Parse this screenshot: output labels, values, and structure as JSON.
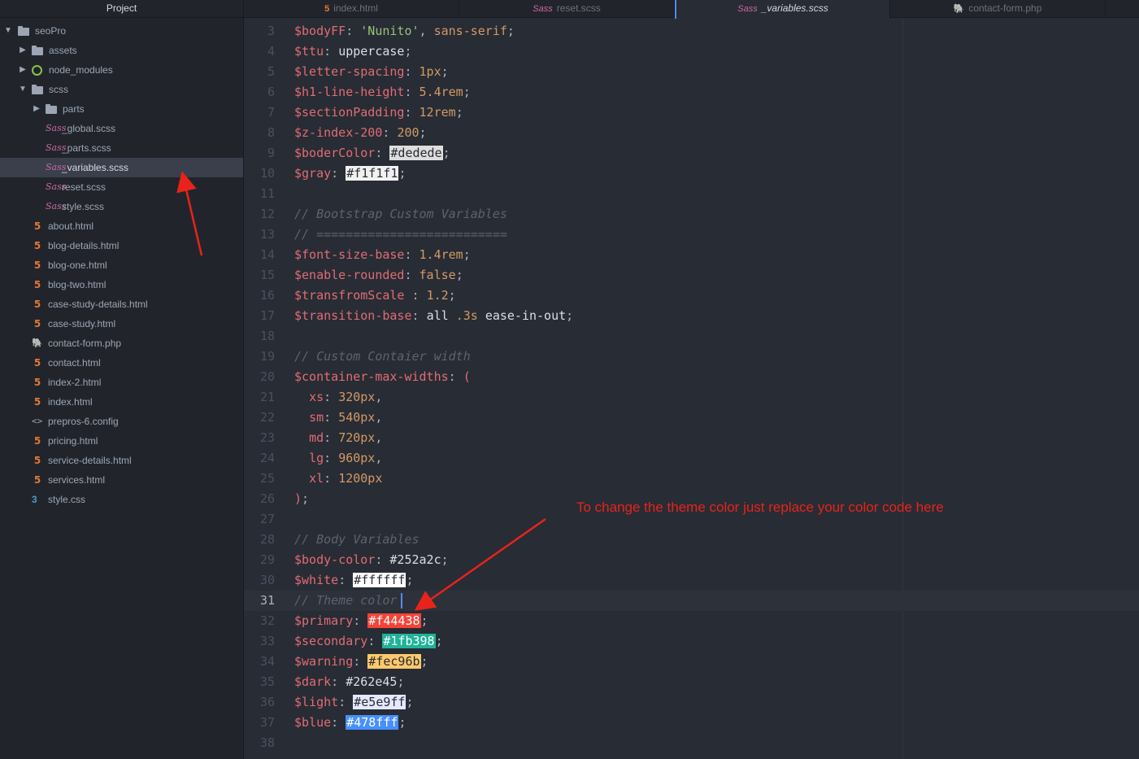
{
  "sidebar": {
    "title": "Project",
    "root": "seoPro",
    "items": [
      {
        "label": "assets",
        "type": "folder",
        "depth": 1,
        "expanded": false
      },
      {
        "label": "node_modules",
        "type": "npm",
        "depth": 1,
        "expanded": false
      },
      {
        "label": "scss",
        "type": "folder",
        "depth": 1,
        "expanded": true
      },
      {
        "label": "parts",
        "type": "folder",
        "depth": 2,
        "expanded": false
      },
      {
        "label": "_global.scss",
        "type": "sass",
        "depth": 2
      },
      {
        "label": "_parts.scss",
        "type": "sass",
        "depth": 2
      },
      {
        "label": "_variables.scss",
        "type": "sass",
        "depth": 2,
        "selected": true
      },
      {
        "label": "reset.scss",
        "type": "sass",
        "depth": 2
      },
      {
        "label": "style.scss",
        "type": "sass",
        "depth": 2
      },
      {
        "label": "about.html",
        "type": "html",
        "depth": 1
      },
      {
        "label": "blog-details.html",
        "type": "html",
        "depth": 1
      },
      {
        "label": "blog-one.html",
        "type": "html",
        "depth": 1
      },
      {
        "label": "blog-two.html",
        "type": "html",
        "depth": 1
      },
      {
        "label": "case-study-details.html",
        "type": "html",
        "depth": 1
      },
      {
        "label": "case-study.html",
        "type": "html",
        "depth": 1
      },
      {
        "label": "contact-form.php",
        "type": "php",
        "depth": 1
      },
      {
        "label": "contact.html",
        "type": "html",
        "depth": 1
      },
      {
        "label": "index-2.html",
        "type": "html",
        "depth": 1
      },
      {
        "label": "index.html",
        "type": "html",
        "depth": 1
      },
      {
        "label": "prepros-6.config",
        "type": "cfg",
        "depth": 1
      },
      {
        "label": "pricing.html",
        "type": "html",
        "depth": 1
      },
      {
        "label": "service-details.html",
        "type": "html",
        "depth": 1
      },
      {
        "label": "services.html",
        "type": "html",
        "depth": 1
      },
      {
        "label": "style.css",
        "type": "css",
        "depth": 1
      }
    ]
  },
  "tabs": [
    {
      "label": "index.html",
      "icon": "html-icon",
      "active": false
    },
    {
      "label": "reset.scss",
      "icon": "sass-icon",
      "active": false
    },
    {
      "label": "_variables.scss",
      "icon": "sass-icon",
      "active": true
    },
    {
      "label": "contact-form.php",
      "icon": "php-icon",
      "active": false
    }
  ],
  "editor": {
    "cursor_line": 31,
    "lines": [
      {
        "n": "3",
        "tokens": [
          [
            "var",
            "$bodyFF"
          ],
          [
            "plain",
            ": "
          ],
          [
            "str",
            "'Nunito'"
          ],
          [
            "plain",
            ", "
          ],
          [
            "kw",
            "sans-serif"
          ],
          [
            "plain",
            ";"
          ]
        ]
      },
      {
        "n": "4",
        "tokens": [
          [
            "var",
            "$ttu"
          ],
          [
            "plain",
            ": "
          ],
          [
            "white",
            "uppercase"
          ],
          [
            "plain",
            ";"
          ]
        ]
      },
      {
        "n": "5",
        "tokens": [
          [
            "var",
            "$letter-spacing"
          ],
          [
            "plain",
            ": "
          ],
          [
            "num",
            "1px"
          ],
          [
            "plain",
            ";"
          ]
        ]
      },
      {
        "n": "6",
        "tokens": [
          [
            "var",
            "$h1-line-height"
          ],
          [
            "plain",
            ": "
          ],
          [
            "num",
            "5.4rem"
          ],
          [
            "plain",
            ";"
          ]
        ]
      },
      {
        "n": "7",
        "tokens": [
          [
            "var",
            "$sectionPadding"
          ],
          [
            "plain",
            ": "
          ],
          [
            "num",
            "12rem"
          ],
          [
            "plain",
            ";"
          ]
        ]
      },
      {
        "n": "8",
        "tokens": [
          [
            "var",
            "$z-index-200"
          ],
          [
            "plain",
            ": "
          ],
          [
            "num",
            "200"
          ],
          [
            "plain",
            ";"
          ]
        ]
      },
      {
        "n": "9",
        "tokens": [
          [
            "var",
            "$boderColor"
          ],
          [
            "plain",
            ": "
          ],
          [
            "swatch",
            "#dedede",
            "#dedede",
            "#282c34"
          ],
          [
            "plain",
            ";"
          ]
        ]
      },
      {
        "n": "10",
        "tokens": [
          [
            "var",
            "$gray"
          ],
          [
            "plain",
            ": "
          ],
          [
            "swatch",
            "#f1f1f1",
            "#f1f1f1",
            "#282c34"
          ],
          [
            "plain",
            ";"
          ]
        ]
      },
      {
        "n": "11",
        "tokens": []
      },
      {
        "n": "12",
        "tokens": [
          [
            "cmt",
            "// Bootstrap Custom Variables"
          ]
        ]
      },
      {
        "n": "13",
        "tokens": [
          [
            "cmt",
            "// =========================="
          ]
        ]
      },
      {
        "n": "14",
        "tokens": [
          [
            "var",
            "$font-size-base"
          ],
          [
            "plain",
            ": "
          ],
          [
            "num",
            "1.4rem"
          ],
          [
            "plain",
            ";"
          ]
        ]
      },
      {
        "n": "15",
        "tokens": [
          [
            "var",
            "$enable-rounded"
          ],
          [
            "plain",
            ": "
          ],
          [
            "kw",
            "false"
          ],
          [
            "plain",
            ";"
          ]
        ]
      },
      {
        "n": "16",
        "tokens": [
          [
            "var",
            "$transfromScale "
          ],
          [
            "plain",
            ": "
          ],
          [
            "num",
            "1.2"
          ],
          [
            "plain",
            ";"
          ]
        ]
      },
      {
        "n": "17",
        "tokens": [
          [
            "var",
            "$transition-base"
          ],
          [
            "plain",
            ": "
          ],
          [
            "white",
            "all "
          ],
          [
            "num",
            ".3s "
          ],
          [
            "white",
            "ease-in-out"
          ],
          [
            "plain",
            ";"
          ]
        ]
      },
      {
        "n": "18",
        "tokens": []
      },
      {
        "n": "19",
        "tokens": [
          [
            "cmt",
            "// Custom Contaier width"
          ]
        ]
      },
      {
        "n": "20",
        "tokens": [
          [
            "var",
            "$container-max-widths"
          ],
          [
            "plain",
            ": "
          ],
          [
            "var",
            "("
          ]
        ]
      },
      {
        "n": "21",
        "tokens": [
          [
            "plain",
            "  "
          ],
          [
            "var",
            "xs"
          ],
          [
            "plain",
            ": "
          ],
          [
            "num",
            "320px"
          ],
          [
            "plain",
            ","
          ]
        ]
      },
      {
        "n": "22",
        "tokens": [
          [
            "plain",
            "  "
          ],
          [
            "var",
            "sm"
          ],
          [
            "plain",
            ": "
          ],
          [
            "num",
            "540px"
          ],
          [
            "plain",
            ","
          ]
        ]
      },
      {
        "n": "23",
        "tokens": [
          [
            "plain",
            "  "
          ],
          [
            "var",
            "md"
          ],
          [
            "plain",
            ": "
          ],
          [
            "num",
            "720px"
          ],
          [
            "plain",
            ","
          ]
        ]
      },
      {
        "n": "24",
        "tokens": [
          [
            "plain",
            "  "
          ],
          [
            "var",
            "lg"
          ],
          [
            "plain",
            ": "
          ],
          [
            "num",
            "960px"
          ],
          [
            "plain",
            ","
          ]
        ]
      },
      {
        "n": "25",
        "tokens": [
          [
            "plain",
            "  "
          ],
          [
            "var",
            "xl"
          ],
          [
            "plain",
            ": "
          ],
          [
            "num",
            "1200px"
          ]
        ]
      },
      {
        "n": "26",
        "tokens": [
          [
            "var",
            ")"
          ],
          [
            "plain",
            ";"
          ]
        ]
      },
      {
        "n": "27",
        "tokens": []
      },
      {
        "n": "28",
        "tokens": [
          [
            "cmt",
            "// Body Variables"
          ]
        ]
      },
      {
        "n": "29",
        "tokens": [
          [
            "var",
            "$body-color"
          ],
          [
            "plain",
            ": "
          ],
          [
            "white",
            "#252a2c"
          ],
          [
            "plain",
            ";"
          ]
        ]
      },
      {
        "n": "30",
        "tokens": [
          [
            "var",
            "$white"
          ],
          [
            "plain",
            ": "
          ],
          [
            "swatch",
            "#ffffff",
            "#ffffff",
            "#282c34"
          ],
          [
            "plain",
            ";"
          ]
        ]
      },
      {
        "n": "31",
        "tokens": [
          [
            "cmt",
            "// Theme color"
          ]
        ]
      },
      {
        "n": "32",
        "tokens": [
          [
            "var",
            "$primary"
          ],
          [
            "plain",
            ": "
          ],
          [
            "swatch",
            "#f44438",
            "#f44438",
            "#ffffff"
          ],
          [
            "plain",
            ";"
          ]
        ]
      },
      {
        "n": "33",
        "tokens": [
          [
            "var",
            "$secondary"
          ],
          [
            "plain",
            ": "
          ],
          [
            "swatch",
            "#1fb398",
            "#1fb398",
            "#ffffff"
          ],
          [
            "plain",
            ";"
          ]
        ]
      },
      {
        "n": "34",
        "tokens": [
          [
            "var",
            "$warning"
          ],
          [
            "plain",
            ": "
          ],
          [
            "swatch",
            "#fec96b",
            "#fec96b",
            "#282c34"
          ],
          [
            "plain",
            ";"
          ]
        ]
      },
      {
        "n": "35",
        "tokens": [
          [
            "var",
            "$dark"
          ],
          [
            "plain",
            ": "
          ],
          [
            "white",
            "#262e45"
          ],
          [
            "plain",
            ";"
          ]
        ]
      },
      {
        "n": "36",
        "tokens": [
          [
            "var",
            "$light"
          ],
          [
            "plain",
            ": "
          ],
          [
            "swatch",
            "#e5e9ff",
            "#e5e9ff",
            "#282c34"
          ],
          [
            "plain",
            ";"
          ]
        ]
      },
      {
        "n": "37",
        "tokens": [
          [
            "var",
            "$blue"
          ],
          [
            "plain",
            ": "
          ],
          [
            "swatch",
            "#478fff",
            "#478fff",
            "#ffffff"
          ],
          [
            "plain",
            ";"
          ]
        ]
      },
      {
        "n": "38",
        "tokens": []
      }
    ]
  },
  "annotation": {
    "text": "To change the theme color just replace your color code here",
    "color": "#e8231b"
  }
}
